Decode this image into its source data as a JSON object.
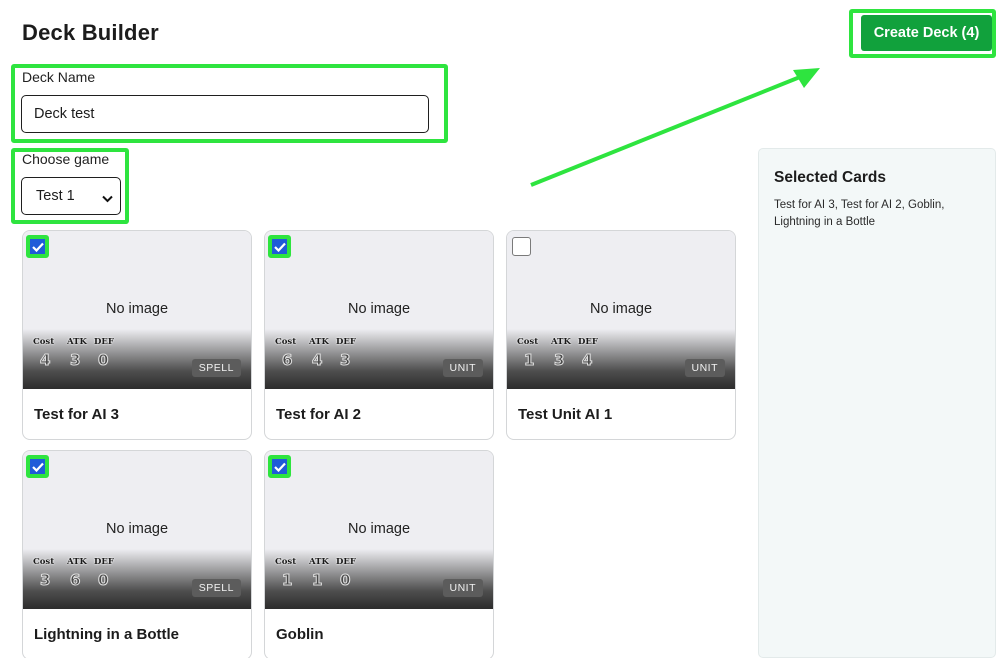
{
  "header": {
    "title": "Deck Builder",
    "create_button": "Create Deck (4)"
  },
  "form": {
    "deck_name_label": "Deck Name",
    "deck_name_value": "Deck test",
    "game_label": "Choose game",
    "game_selected": "Test 1"
  },
  "selected_panel": {
    "title": "Selected Cards",
    "text": "Test for AI 3, Test for AI 2, Goblin, Lightning in a Bottle"
  },
  "stat_labels": {
    "cost": "Cost",
    "atk": "ATK",
    "def": "DEF"
  },
  "no_image": "No image",
  "cards": [
    {
      "name": "Test for AI 3",
      "cost": "4",
      "atk": "3",
      "def": "0",
      "type": "SPELL",
      "checked": true
    },
    {
      "name": "Test for AI 2",
      "cost": "6",
      "atk": "4",
      "def": "3",
      "type": "UNIT",
      "checked": true
    },
    {
      "name": "Test Unit AI 1",
      "cost": "1",
      "atk": "3",
      "def": "4",
      "type": "UNIT",
      "checked": false
    },
    {
      "name": "Lightning in a Bottle",
      "cost": "3",
      "atk": "6",
      "def": "0",
      "type": "SPELL",
      "checked": true
    },
    {
      "name": "Goblin",
      "cost": "1",
      "atk": "1",
      "def": "0",
      "type": "UNIT",
      "checked": true
    }
  ],
  "colors": {
    "accent_button": "#11a13c",
    "highlight": "#2ee43f",
    "checkbox": "#1f5bd8",
    "panel_bg": "#f3f8f8"
  },
  "icons": {
    "checkbox_checked": "check-icon",
    "select": "chevron-down-icon"
  }
}
